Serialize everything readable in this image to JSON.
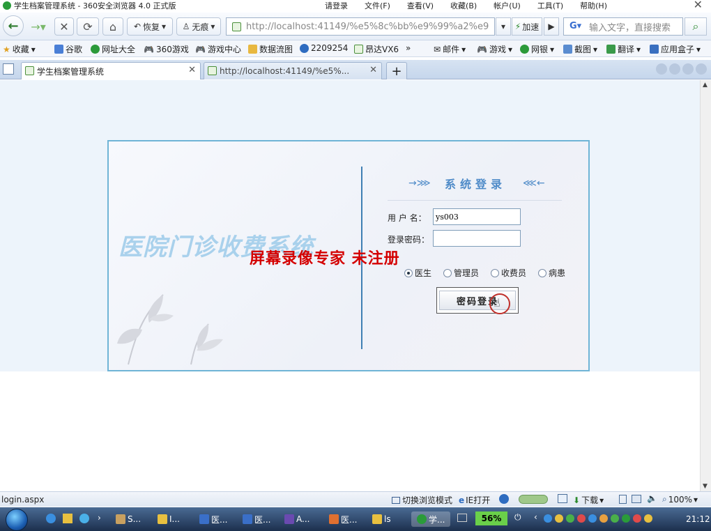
{
  "window": {
    "title": "学生档案管理系统 - 360安全浏览器 4.0 正式版",
    "menu": [
      "请登录",
      "文件(F)",
      "查看(V)",
      "收藏(B)",
      "帐户(U)",
      "工具(T)",
      "帮助(H)"
    ]
  },
  "toolbar": {
    "restore_label": "恢复",
    "incognito_label": "无痕",
    "address": "http://localhost:41149/%e5%8c%bb%e9%99%a2%e9",
    "accelerate_label": "加速",
    "search_placeholder": "输入文字，直接搜索"
  },
  "bookmarks": {
    "items": [
      "收藏",
      "谷歌",
      "网址大全",
      "360游戏",
      "游戏中心",
      "数据流图",
      "2209254",
      "昂达VX6",
      "邮件",
      "游戏",
      "网银",
      "截图",
      "翻译",
      "应用盒子"
    ],
    "more": "»"
  },
  "tabs": [
    {
      "label": "学生档案管理系统"
    },
    {
      "label": "http://localhost:41149/%e5%..."
    }
  ],
  "login": {
    "section_title": "系统登录",
    "banner_title": "医院门诊收费系统",
    "username_label": "用 户 名：",
    "username_value": "ys003",
    "password_label": "登录密码：",
    "password_value": "",
    "roles": [
      "医生",
      "管理员",
      "收费员",
      "病患"
    ],
    "selected_role": "医生",
    "submit_label": "密码登录"
  },
  "watermark": "屏幕录像专家  未注册",
  "status": {
    "url": "login.aspx",
    "mode_label": "切换浏览模式",
    "ie_label": "IE打开",
    "download_label": "下载",
    "zoom": "100%"
  },
  "taskbar": {
    "items": [
      "S...",
      "I...",
      "医...",
      "医...",
      "A...",
      "医...",
      "ls",
      "学..."
    ],
    "cpu": "56%",
    "clock": "21:12"
  },
  "colors": {
    "accent": "#4f8bc8",
    "panel_border": "#6fb4d6",
    "watermark": "#d40000"
  }
}
